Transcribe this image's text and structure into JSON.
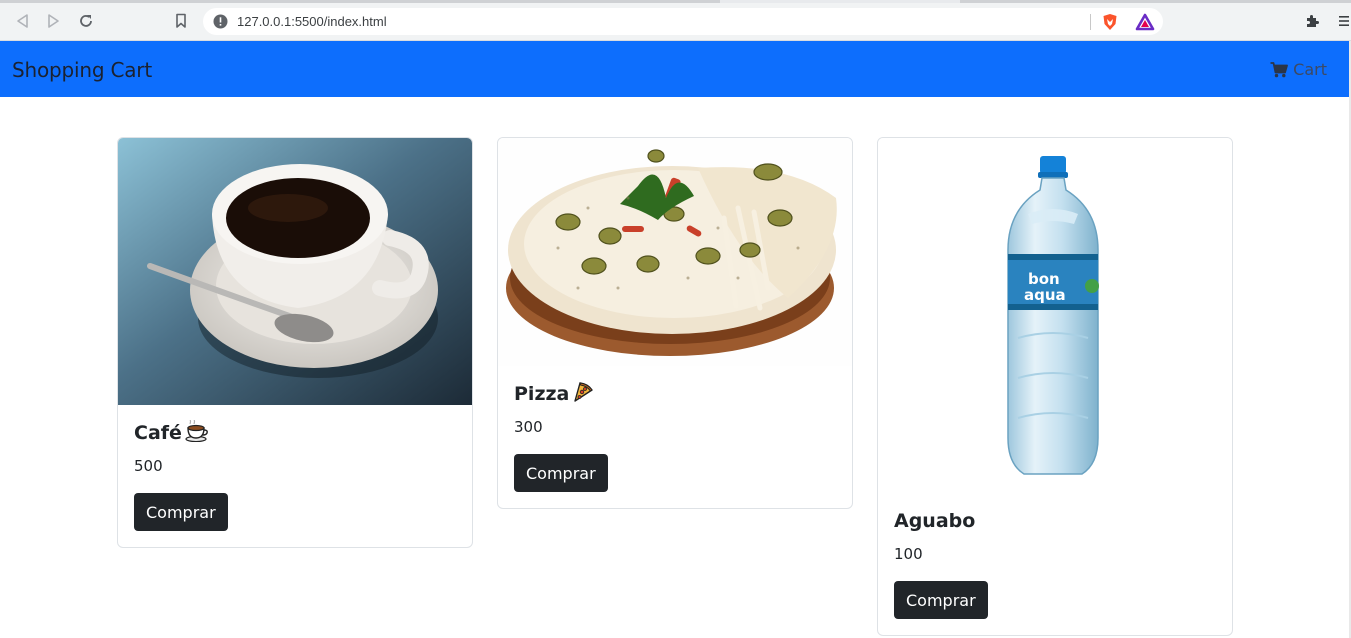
{
  "browser": {
    "url": "127.0.0.1:5500/index.html"
  },
  "navbar": {
    "brand": "Shopping Cart",
    "cart_label": "Cart",
    "color": "#0d6efd"
  },
  "products": [
    {
      "name": "Café",
      "emoji_icon": "coffee-cup-icon",
      "price": "500",
      "button": "Comprar",
      "image_icon": "coffee-cup-photo"
    },
    {
      "name": "Pizza",
      "emoji_icon": "pizza-slice-icon",
      "price": "300",
      "button": "Comprar",
      "image_icon": "pizza-photo"
    },
    {
      "name": "Aguabo",
      "price": "100",
      "button": "Comprar",
      "image_icon": "water-bottle-photo"
    }
  ]
}
